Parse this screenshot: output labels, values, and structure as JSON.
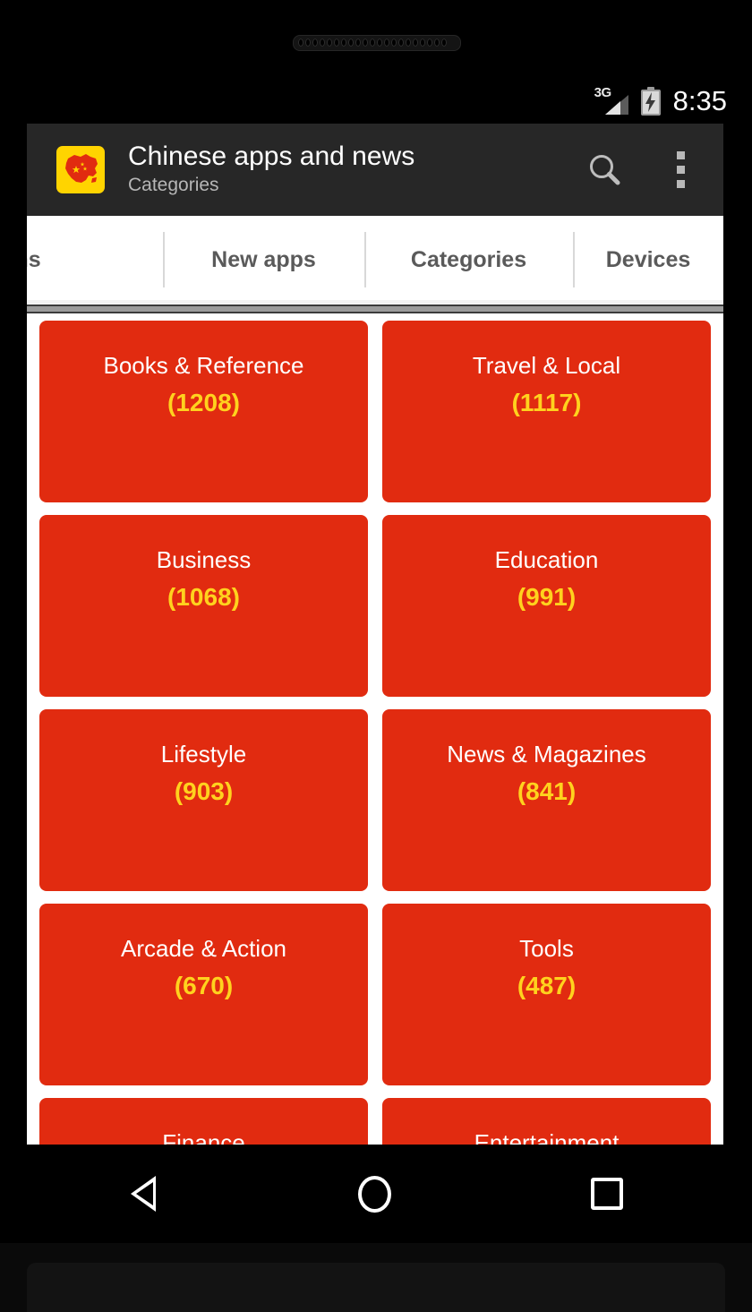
{
  "status_bar": {
    "network": "3G",
    "time": "8:35",
    "battery_icon": "battery-charging-icon",
    "signal_icon": "signal-3g-icon"
  },
  "action_bar": {
    "app_icon": "china-map-icon",
    "title": "Chinese apps and news",
    "subtitle": "Categories",
    "search_icon": "search-icon",
    "overflow_icon": "overflow-menu-icon"
  },
  "tabs": [
    {
      "label": "ations",
      "full_label": "Applications",
      "selected": false
    },
    {
      "label": "New apps",
      "selected": false
    },
    {
      "label": "Categories",
      "selected": true
    },
    {
      "label": "Devices",
      "selected": false
    }
  ],
  "categories": [
    {
      "name": "Books & Reference",
      "count": "(1208)"
    },
    {
      "name": "Travel & Local",
      "count": "(1117)"
    },
    {
      "name": "Business",
      "count": "(1068)"
    },
    {
      "name": "Education",
      "count": "(991)"
    },
    {
      "name": "Lifestyle",
      "count": "(903)"
    },
    {
      "name": "News & Magazines",
      "count": "(841)"
    },
    {
      "name": "Arcade & Action",
      "count": "(670)"
    },
    {
      "name": "Tools",
      "count": "(487)"
    },
    {
      "name": "Finance",
      "count": ""
    },
    {
      "name": "Entertainment",
      "count": ""
    }
  ],
  "nav_bar": {
    "back": "back-icon",
    "home": "home-icon",
    "recents": "recents-icon"
  },
  "colors": {
    "card_red": "#E12B10",
    "count_yellow": "#FFD21E",
    "action_bar": "#272727",
    "icon_yellow": "#FFD400",
    "tab_text": "#5A5A5A"
  }
}
